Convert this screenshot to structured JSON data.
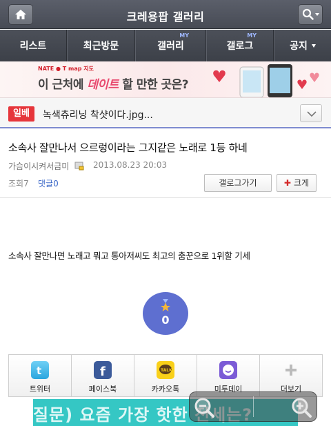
{
  "header": {
    "title": "크레용팝 갤러리",
    "home_icon": "home-icon",
    "search_icon": "search-icon"
  },
  "nav": {
    "tabs": [
      {
        "label": "리스트",
        "my": ""
      },
      {
        "label": "최근방문",
        "my": ""
      },
      {
        "label": "갤러리",
        "my": "MY"
      },
      {
        "label": "갤로그",
        "my": "MY"
      },
      {
        "label": "공지",
        "my": ""
      }
    ]
  },
  "banner": {
    "brand": "NATE ● T map 지도",
    "text_prefix": "이 근처에 ",
    "text_highlight": "데이트",
    "text_suffix": " 할 만한 곳은?"
  },
  "subject": {
    "badge": "일베",
    "filename": "녹색츄리닝 착샷이다.jpg..."
  },
  "post": {
    "title": "소속사 잘만나서 으르렁이라는 그지같은 노래로 1등 하네",
    "author": "가슴이시켜서금미",
    "date": "2013.08.23 20:03",
    "views": "조회7",
    "comments": "댓글0",
    "gallog_button": "갤로그가기",
    "zoom_button": "크게",
    "body": "소속사 잘만나면 노래고 뭐고 통아저씨도 최고의 춤꾼으로 1위할 기세",
    "recommend_count": "0"
  },
  "share": [
    {
      "label": "트위터",
      "icon": "twitter-icon"
    },
    {
      "label": "페이스북",
      "icon": "facebook-icon"
    },
    {
      "label": "카카오톡",
      "icon": "kakaotalk-icon"
    },
    {
      "label": "미투데이",
      "icon": "me2day-icon"
    },
    {
      "label": "더보기",
      "icon": "more-icon"
    }
  ],
  "bottom_ad": {
    "text": "질문) 요즘 가장 핫한 전세는?"
  },
  "colors": {
    "accent": "#5e6fd0",
    "badge": "#e6363b",
    "link": "#3b68c8"
  }
}
